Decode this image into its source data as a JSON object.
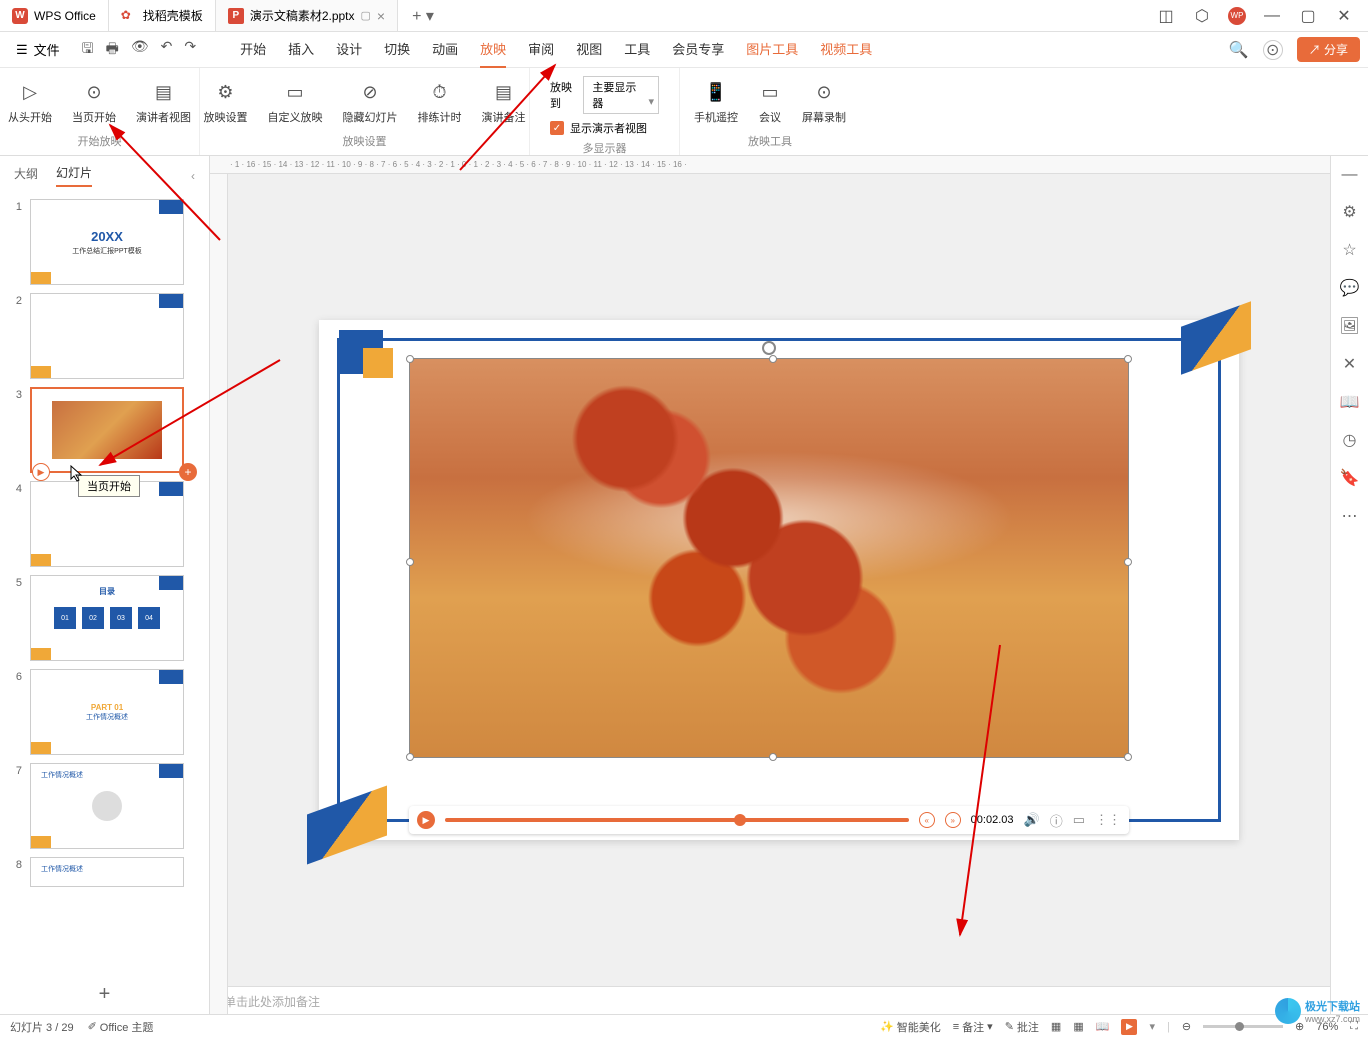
{
  "title_bar": {
    "app_name": "WPS Office",
    "tab_docer": "找稻壳模板",
    "doc_name": "演示文稿素材2.pptx",
    "user_badge": "WP"
  },
  "menu": {
    "file": "文件",
    "tabs": [
      "开始",
      "插入",
      "设计",
      "切换",
      "动画",
      "放映",
      "审阅",
      "视图",
      "工具",
      "会员专享",
      "图片工具",
      "视频工具"
    ],
    "active_tab": "放映",
    "share": "分享"
  },
  "ribbon": {
    "group1": {
      "name": "开始放映",
      "items": [
        "从头开始",
        "当页开始",
        "演讲者视图"
      ]
    },
    "group2": {
      "name": "放映设置",
      "items": [
        "放映设置",
        "自定义放映",
        "隐藏幻灯片",
        "排练计时",
        "演讲备注"
      ]
    },
    "group3": {
      "name": "多显示器",
      "to_label": "放映到",
      "monitor": "主要显示器",
      "show_presenter": "显示演示者视图"
    },
    "group4": {
      "name": "放映工具",
      "items": [
        "手机遥控",
        "会议",
        "屏幕录制"
      ]
    }
  },
  "panel": {
    "tab_outline": "大纲",
    "tab_slides": "幻灯片",
    "tooltip": "当页开始",
    "slide1": {
      "year": "20XX",
      "title": "工作总结汇报PPT模板"
    },
    "slide5_title": "目录",
    "slide5_items": [
      "01",
      "02",
      "03",
      "04"
    ],
    "slide6": {
      "part": "PART 01",
      "title": "工作情况概述"
    },
    "slide7_title": "工作情况概述",
    "slide8_title": "工作情况概述"
  },
  "video": {
    "timestamp": "00:02.03"
  },
  "notes_placeholder": "单击此处添加备注",
  "status": {
    "slide_counter": "幻灯片 3 / 29",
    "theme_label": "Office 主题",
    "beautify": "智能美化",
    "notes": "备注",
    "comments": "批注",
    "zoom": "76%"
  },
  "watermark": {
    "name": "极光下载站",
    "url": "www.xz7.com"
  }
}
